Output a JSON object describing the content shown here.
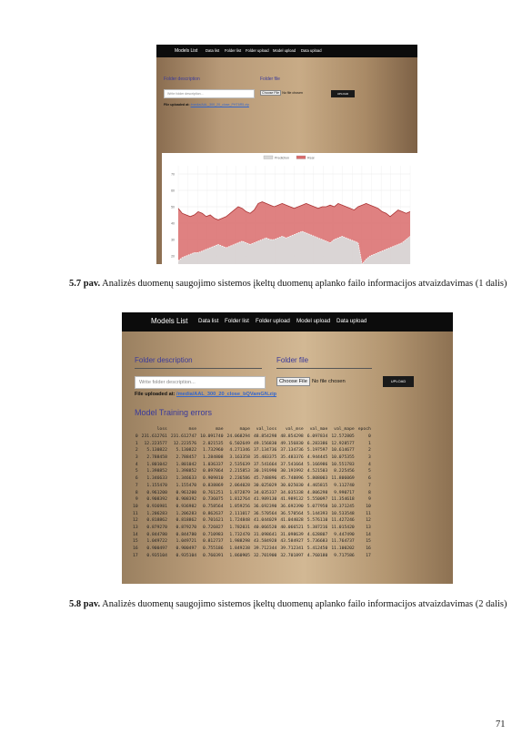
{
  "shot1": {
    "nav": {
      "brand": "Models List",
      "items": [
        "Data list",
        "Folder list",
        "Folder upload",
        "Model upload",
        "Data upload"
      ]
    },
    "folder_description_label": "Folder description",
    "folder_file_label": "Folder file",
    "description_placeholder": "Write folder description...",
    "choose_file_label": "Choose File",
    "no_file_label": "No file chosen",
    "upload_label": "UPLOAD",
    "uploaded_prefix": "File uploaded at:",
    "uploaded_link": "/media/AAL_300_20_close_PHT6R5.zip",
    "chart_data": {
      "type": "area",
      "legend": [
        "Prediction",
        "Real"
      ],
      "colors": {
        "Prediction": "#d9d9d9",
        "Real": "#d96b6b"
      },
      "legend_position": "top-center",
      "yticks": [
        70,
        60,
        50,
        40,
        30,
        20
      ],
      "ylim": [
        15,
        75
      ],
      "grid": true,
      "series": [
        {
          "name": "Real",
          "values": [
            49,
            46,
            45,
            44,
            45,
            47,
            46,
            44,
            45,
            43,
            42,
            43,
            44,
            46,
            48,
            50,
            49,
            47,
            46,
            48,
            52,
            53,
            52,
            51,
            50,
            51,
            52,
            51,
            50,
            49,
            50,
            51,
            52,
            51,
            50,
            49,
            50,
            50,
            51,
            50,
            52,
            51,
            50,
            49,
            48,
            50,
            51,
            52,
            51,
            50,
            49,
            47,
            46,
            44,
            46,
            48,
            47,
            46,
            47
          ]
        },
        {
          "name": "Prediction",
          "values": [
            17,
            19,
            20,
            21,
            22,
            22,
            23,
            24,
            25,
            26,
            27,
            26,
            25,
            26,
            27,
            28,
            29,
            28,
            27,
            28,
            29,
            30,
            31,
            30,
            30,
            31,
            32,
            31,
            32,
            33,
            34,
            35,
            34,
            33,
            32,
            31,
            30,
            29,
            28,
            30,
            31,
            32,
            31,
            30,
            29,
            28,
            15,
            18,
            20,
            21,
            22,
            23,
            24,
            25,
            26,
            27,
            28,
            30,
            32
          ]
        }
      ]
    }
  },
  "caption1": {
    "label": "5.7 pav.",
    "text": " Analizės duomenų saugojimo sistemos įkeltų duomenų aplanko failo informacijos atvaizdavimas (1 dalis)"
  },
  "shot2": {
    "nav": {
      "brand": "Models List",
      "items": [
        "Data list",
        "Folder list",
        "Folder upload",
        "Model upload",
        "Data upload"
      ]
    },
    "folder_description_label": "Folder description",
    "folder_file_label": "Folder file",
    "description_placeholder": "Write folder description...",
    "choose_file_label": "Choose File",
    "no_file_label": "No file chosen",
    "upload_label": "UPLOAD",
    "uploaded_prefix": "File uploaded at:",
    "uploaded_link": "/media/AAL_300_20_close_bQVamGN.zip",
    "section_title": "Model Training errors",
    "table": {
      "columns": [
        "",
        "loss",
        "mse",
        "mae",
        "mape",
        "val_loss",
        "val_mse",
        "val_mae",
        "val_mape",
        "epoch"
      ],
      "rows": [
        [
          "0",
          "231.612761",
          "231.612747",
          "10.091740",
          "24.068294",
          "48.854298",
          "48.854298",
          "6.097834",
          "12.572805",
          "0"
        ],
        [
          "1",
          "12.223577",
          "12.223576",
          "2.021535",
          "6.502649",
          "49.156830",
          "49.156830",
          "6.283386",
          "12.928577",
          "1"
        ],
        [
          "2",
          "5.130822",
          "5.130822",
          "1.732960",
          "4.271346",
          "37.134736",
          "37.134736",
          "5.197597",
          "10.614677",
          "2"
        ],
        [
          "3",
          "2.788458",
          "2.788457",
          "1.284808",
          "3.163358",
          "35.483375",
          "35.483376",
          "4.944445",
          "10.075355",
          "3"
        ],
        [
          "4",
          "1.801042",
          "1.801042",
          "1.036337",
          "2.535639",
          "37.541664",
          "37.541664",
          "5.166986",
          "10.551783",
          "4"
        ],
        [
          "5",
          "1.398852",
          "1.398852",
          "0.897864",
          "2.215853",
          "30.191990",
          "30.191992",
          "4.521503",
          "8.225456",
          "5"
        ],
        [
          "6",
          "1.346633",
          "1.346633",
          "0.909810",
          "2.236586",
          "45.748896",
          "45.748896",
          "5.808003",
          "11.806069",
          "6"
        ],
        [
          "7",
          "1.155470",
          "1.155470",
          "0.838869",
          "2.064028",
          "30.025029",
          "30.025030",
          "4.465815",
          "9.112740",
          "7"
        ],
        [
          "8",
          "0.961200",
          "0.961200",
          "0.761251",
          "1.872879",
          "34.035337",
          "34.035338",
          "4.806298",
          "9.990717",
          "8"
        ],
        [
          "9",
          "0.908392",
          "0.908392",
          "0.736075",
          "1.812764",
          "41.989130",
          "41.989132",
          "5.550097",
          "11.354618",
          "9"
        ],
        [
          "10",
          "0.936981",
          "0.936982",
          "0.758564",
          "1.859256",
          "36.692390",
          "36.692390",
          "5.077950",
          "10.371245",
          "10"
        ],
        [
          "11",
          "1.206283",
          "1.206283",
          "0.862637",
          "2.111017",
          "36.570564",
          "36.570564",
          "5.144393",
          "10.533548",
          "11"
        ],
        [
          "12",
          "0.818862",
          "0.818862",
          "0.701621",
          "1.724848",
          "41.044029",
          "41.044028",
          "5.576110",
          "11.427246",
          "12"
        ],
        [
          "13",
          "0.879270",
          "0.879270",
          "0.726827",
          "1.782031",
          "40.066520",
          "40.066521",
          "5.387216",
          "11.015420",
          "13"
        ],
        [
          "14",
          "0.844780",
          "0.844780",
          "0.710983",
          "1.732470",
          "31.098641",
          "31.098639",
          "4.628807",
          "9.447490",
          "14"
        ],
        [
          "15",
          "1.049722",
          "1.049721",
          "0.812737",
          "1.988298",
          "43.584928",
          "43.584927",
          "5.736683",
          "11.764737",
          "15"
        ],
        [
          "16",
          "0.900497",
          "0.900497",
          "0.755186",
          "1.849238",
          "39.712344",
          "39.712341",
          "5.412450",
          "11.100202",
          "16"
        ],
        [
          "17",
          "0.935104",
          "0.935104",
          "0.760391",
          "1.860905",
          "32.701900",
          "32.701897",
          "4.760180",
          "9.717586",
          "17"
        ]
      ]
    }
  },
  "caption2": {
    "label": "5.8 pav.",
    "text": " Analizės duomenų saugojimo sistemos įkeltų duomenų aplanko failo informacijos atvaizdavimas (2 dalis)"
  },
  "page_number": "71"
}
